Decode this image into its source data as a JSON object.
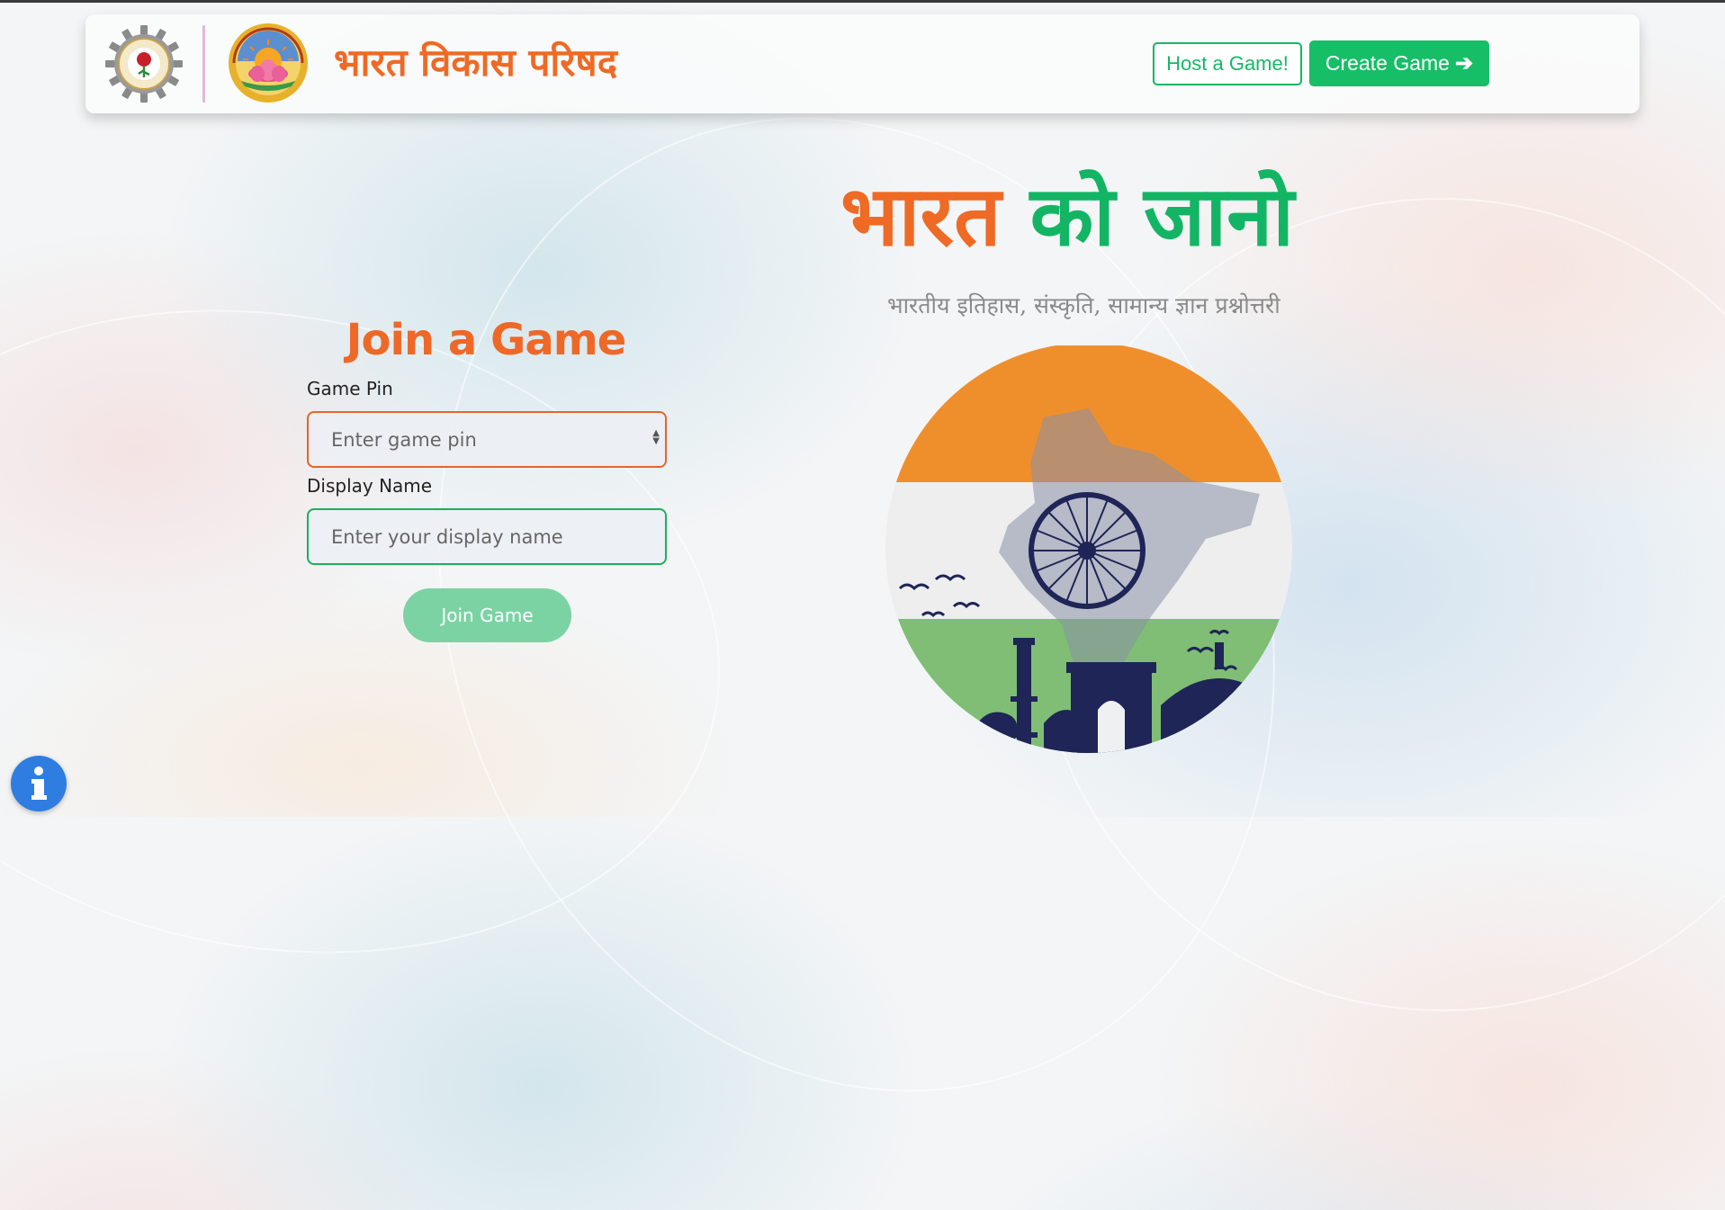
{
  "header": {
    "brand_title": "भारत विकास परिषद",
    "host_label": "Host a Game!",
    "create_label": "Create Game",
    "create_icon": "arrow-right-icon"
  },
  "hero": {
    "title_part1": "भारत",
    "title_part2": "को जानो",
    "subtitle": "भारतीय इतिहास, संस्कृति, सामान्य ज्ञान प्रश्नोत्तरी"
  },
  "join": {
    "title": "Join a Game",
    "pin_label": "Game Pin",
    "pin_placeholder": "Enter game pin",
    "name_label": "Display Name",
    "name_placeholder": "Enter your display name",
    "button_label": "Join Game"
  },
  "info": {
    "icon": "info-icon"
  },
  "colors": {
    "saffron": "#ef6a24",
    "green": "#16bf67",
    "join_button": "#7bd3a4",
    "info_blue": "#2f7de1",
    "navy": "#1f2557"
  }
}
